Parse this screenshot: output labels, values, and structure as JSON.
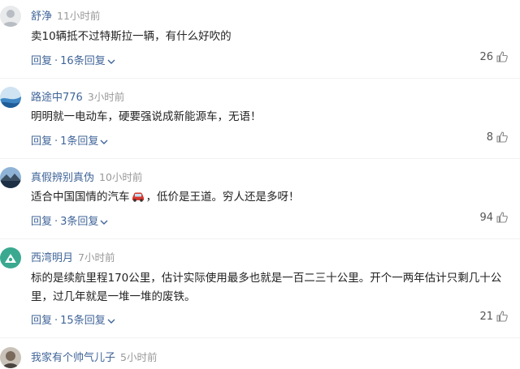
{
  "comments": [
    {
      "username": "舒浄",
      "time": "11小时前",
      "body_lines": [
        "卖10辆抵不过特斯拉一辆，有什么好吹的"
      ],
      "reply_label": "回复",
      "dot": "·",
      "replies_label": "16条回复",
      "likes": "26",
      "avatar_icon": "person-silhouette-avatar"
    },
    {
      "username": "路途中776",
      "time": "3小时前",
      "body_lines": [
        "明明就一电动车，硬要强说成新能源车，无语！"
      ],
      "reply_label": "回复",
      "dot": "·",
      "replies_label": "1条回复",
      "likes": "8",
      "avatar_icon": "blue-landscape-avatar"
    },
    {
      "username": "真假辨别真伪",
      "time": "10小时前",
      "body_lines_parts": [
        "适合中国国情的汽车",
        "，低价是王道。穷人还是多呀！"
      ],
      "car_emoji": "car-emoji-icon",
      "reply_label": "回复",
      "dot": "·",
      "replies_label": "3条回复",
      "likes": "94",
      "avatar_icon": "mountain-lake-avatar"
    },
    {
      "username": "西湾明月",
      "time": "7小时前",
      "body_lines": [
        "标的是续航里程170公里，估计实际使用最多也就是一百二三十公里。开个一两年估计只剩几十公",
        "里，过几年就是一堆一堆的废铁。"
      ],
      "reply_label": "回复",
      "dot": "·",
      "replies_label": "15条回复",
      "likes": "21",
      "avatar_icon": "green-tent-avatar"
    },
    {
      "username": "我家有个帅气儿子",
      "time": "5小时前",
      "avatar_icon": "child-photo-avatar"
    }
  ],
  "colors": {
    "username": "#406599",
    "time": "#999999",
    "body": "#222222",
    "action": "#406599",
    "likes": "#555555"
  }
}
